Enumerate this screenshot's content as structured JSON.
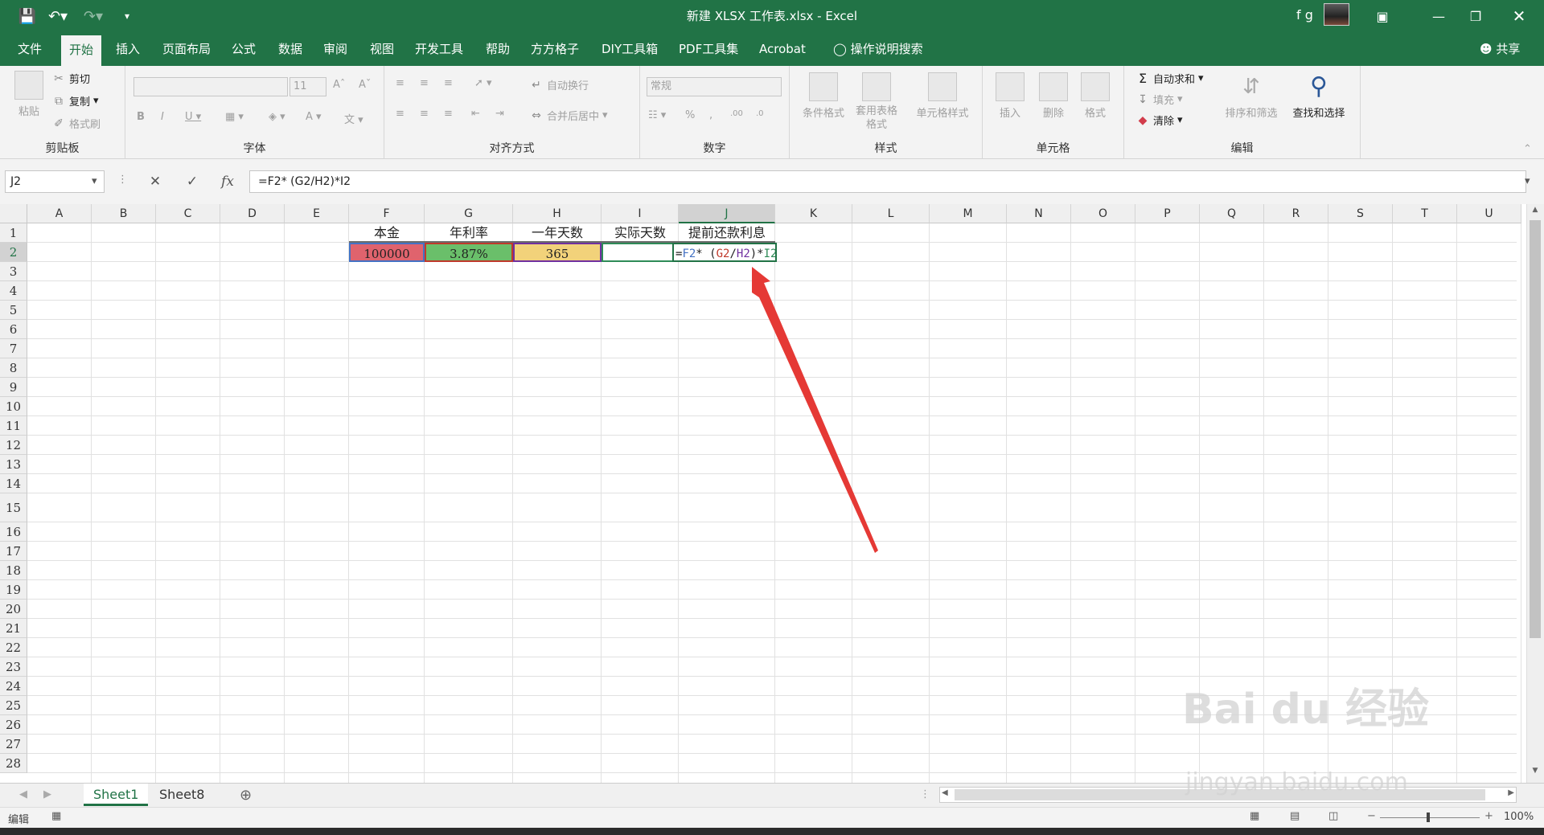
{
  "window": {
    "title": "新建 XLSX 工作表.xlsx - Excel",
    "user": "f g"
  },
  "tabs": [
    "文件",
    "开始",
    "插入",
    "页面布局",
    "公式",
    "数据",
    "审阅",
    "视图",
    "开发工具",
    "帮助",
    "方方格子",
    "DIY工具箱",
    "PDF工具集",
    "Acrobat"
  ],
  "active_tab": "开始",
  "tell_me": "操作说明搜索",
  "share": "共享",
  "ribbon": {
    "clipboard": {
      "label": "剪贴板",
      "paste": "粘贴",
      "cut": "剪切",
      "copy": "复制",
      "format_painter": "格式刷"
    },
    "font": {
      "label": "字体",
      "font_size": "11"
    },
    "alignment": {
      "label": "对齐方式",
      "wrap": "自动换行",
      "merge": "合并后居中"
    },
    "number": {
      "label": "数字",
      "format": "常规"
    },
    "styles": {
      "label": "样式",
      "conditional": "条件格式",
      "table": "套用表格格式",
      "cell_styles": "单元格样式"
    },
    "cells": {
      "label": "单元格",
      "insert": "插入",
      "delete": "删除",
      "format": "格式"
    },
    "editing": {
      "label": "编辑",
      "autosum": "自动求和",
      "fill": "填充",
      "clear": "清除",
      "sort": "排序和筛选",
      "find": "查找和选择"
    }
  },
  "formula_bar": {
    "name_box": "J2",
    "formula": "=F2*  (G2/H2)*I2"
  },
  "columns": [
    "A",
    "B",
    "C",
    "D",
    "E",
    "F",
    "G",
    "H",
    "I",
    "J",
    "K",
    "L",
    "M",
    "N",
    "O",
    "P",
    "Q",
    "R",
    "S",
    "T",
    "U"
  ],
  "rows": [
    "1",
    "2",
    "3",
    "4",
    "5",
    "6",
    "7",
    "8",
    "9",
    "10",
    "11",
    "12",
    "13",
    "14",
    "15",
    "16",
    "17",
    "18",
    "19",
    "20",
    "21",
    "22",
    "23",
    "24",
    "25",
    "26",
    "27",
    "28"
  ],
  "cells": {
    "F1": "本金",
    "G1": "年利率",
    "H1": "一年天数",
    "I1": "实际天数",
    "J1": "提前还款利息",
    "F2": "100000",
    "G2": "3.87%",
    "H2": "365",
    "I2": "",
    "J2_parts": [
      "=",
      "F2",
      "*  (",
      "G2",
      "/",
      "H2",
      ")*",
      "I2"
    ]
  },
  "cell_colors": {
    "F2": "#e0636d",
    "G2": "#6abf6a",
    "H2": "#f2d27a"
  },
  "ref_colors": {
    "F2": "#4472c4",
    "G2": "#c0392b",
    "H2": "#7030a0",
    "I2": "#2e8b57"
  },
  "sheets": [
    "Sheet1",
    "Sheet8"
  ],
  "active_sheet": "Sheet1",
  "status": {
    "mode": "编辑",
    "zoom": "100%"
  },
  "watermark": {
    "brand": "Bai du 经验",
    "url": "jingyan.baidu.com"
  }
}
